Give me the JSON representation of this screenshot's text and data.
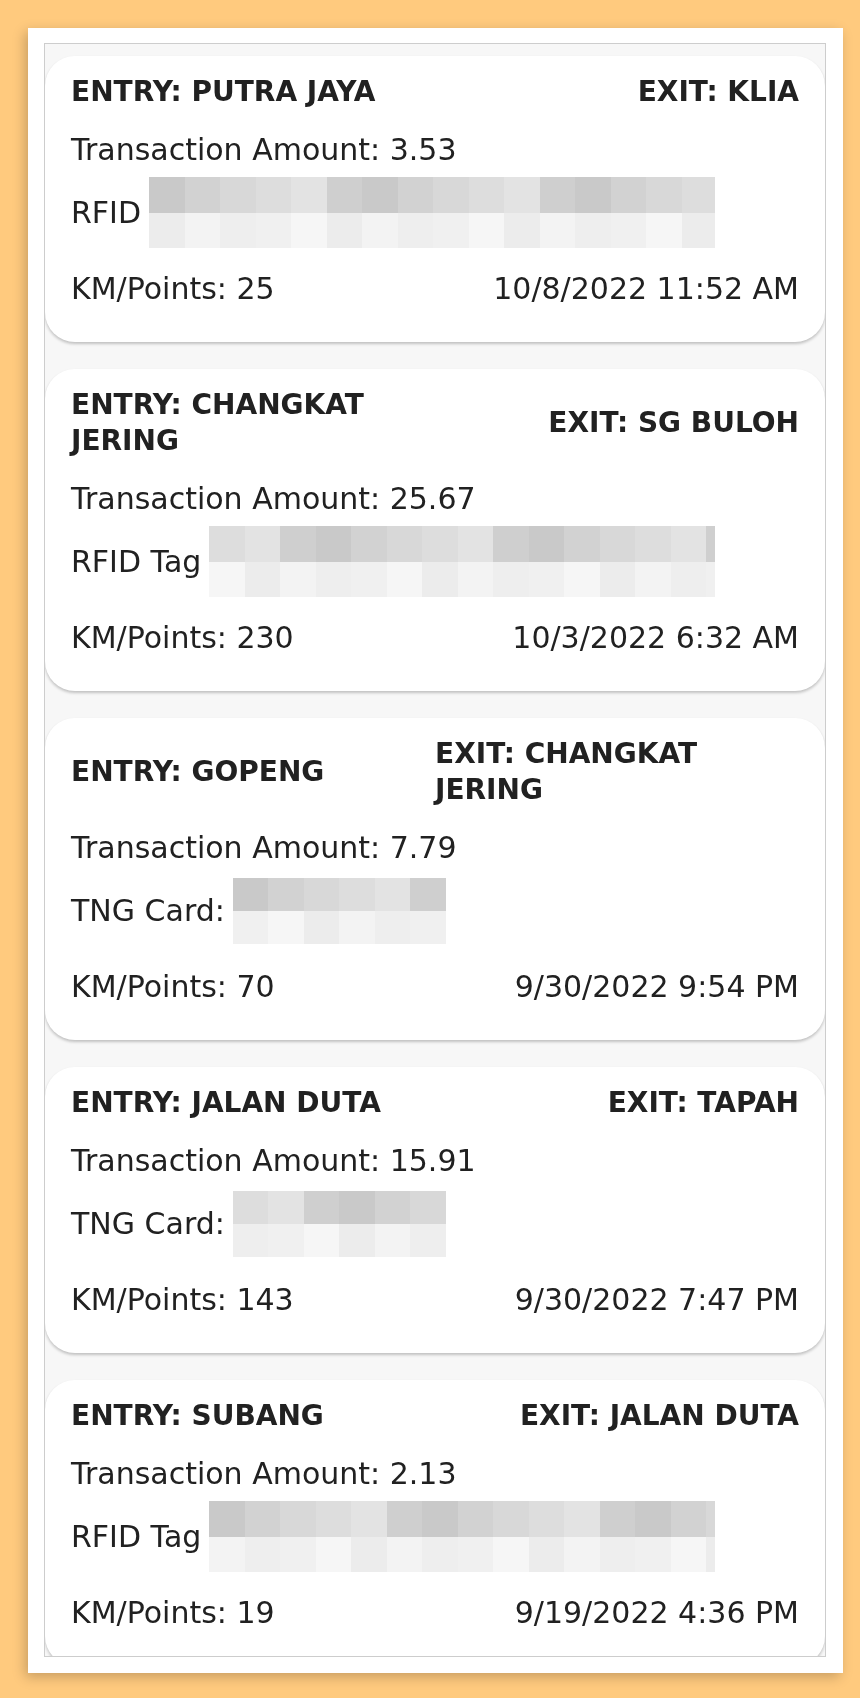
{
  "transactions": [
    {
      "entry": "ENTRY: PUTRA JAYA",
      "exit": "EXIT: KLIA",
      "amount": "Transaction Amount: 3.53",
      "kind": "rfid",
      "id_label": "RFID",
      "points": "KM/Points: 25",
      "datetime": "10/8/2022 11:52 AM"
    },
    {
      "entry": "ENTRY: CHANGKAT JERING",
      "exit": "EXIT: SG BULOH",
      "amount": "Transaction Amount: 25.67",
      "kind": "rfid",
      "id_label": "RFID Tag",
      "points": "KM/Points: 230",
      "datetime": "10/3/2022 6:32 AM"
    },
    {
      "entry": "ENTRY: GOPENG",
      "exit": "EXIT: CHANGKAT JERING",
      "amount": "Transaction Amount: 7.79",
      "kind": "tng_card",
      "id_label": "TNG Card:",
      "points": "KM/Points: 70",
      "datetime": "9/30/2022 9:54 PM"
    },
    {
      "entry": "ENTRY: JALAN DUTA",
      "exit": "EXIT: TAPAH",
      "amount": "Transaction Amount: 15.91",
      "kind": "tng_card",
      "id_label": "TNG Card:",
      "points": "KM/Points: 143",
      "datetime": "9/30/2022 7:47 PM"
    },
    {
      "entry": "ENTRY: SUBANG",
      "exit": "EXIT: JALAN DUTA",
      "amount": "Transaction Amount: 2.13",
      "kind": "rfid",
      "id_label": "RFID Tag",
      "points": "KM/Points: 19",
      "datetime": "9/19/2022 4:36 PM"
    }
  ]
}
